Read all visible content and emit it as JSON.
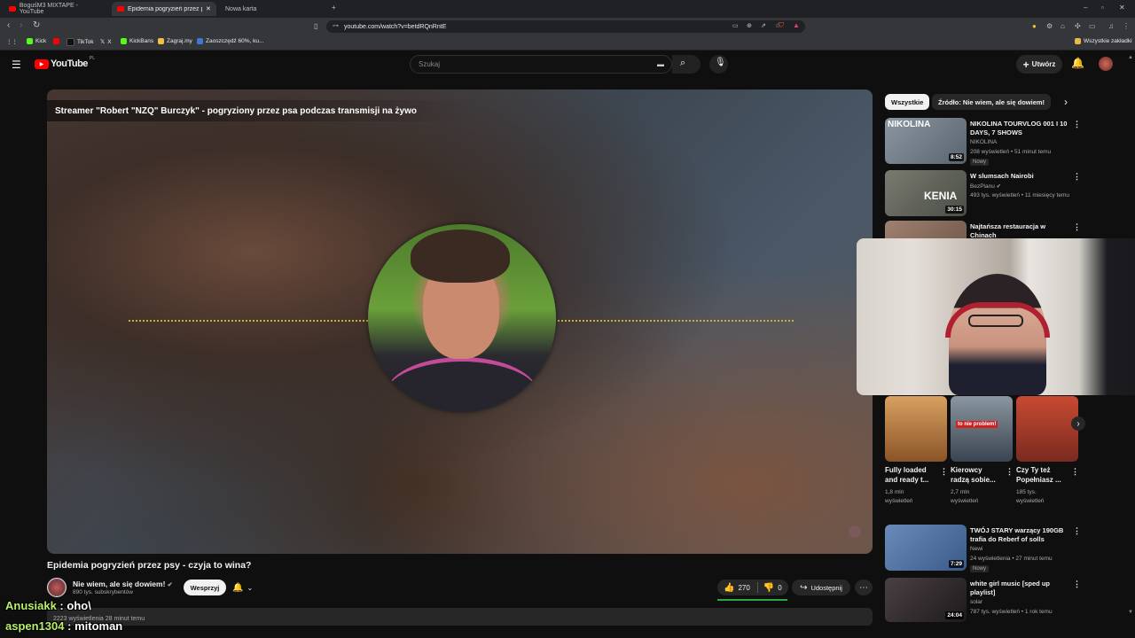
{
  "browser": {
    "tabs": [
      {
        "label": "BoguśM3 MIXTAPE - YouTube",
        "active": false
      },
      {
        "label": "Epidemia pogryzień przez ps",
        "active": true
      },
      {
        "label": "Nowa karta",
        "active": false
      }
    ],
    "url": "youtube.com/watch?v=betdRQnRntE",
    "bookmarks": [
      {
        "label": "Kick",
        "color": "#53fc18"
      },
      {
        "label": "",
        "color": "#ff0000"
      },
      {
        "label": "TikTok",
        "color": "#000000"
      },
      {
        "label": "X",
        "color": "#000000"
      },
      {
        "label": "KickBans",
        "color": "#53fc18"
      },
      {
        "label": "Zagraj.my",
        "color": "#f0c040"
      },
      {
        "label": "Zaoszczędź 60%, ku...",
        "color": "#3a7bd5"
      }
    ],
    "bookmarks_all": "Wszystkie zakładki"
  },
  "youtube": {
    "logo": "YouTube",
    "region": "PL",
    "search_placeholder": "Szukaj",
    "create_label": "Utwórz"
  },
  "video": {
    "overlay_title": "Streamer \"Robert \"NZQ\" Burczyk\" - pogryziony przez psa podczas transmisji na żywo",
    "title": "Epidemia pogryzień przez psy - czyja to wina?",
    "channel": "Nie wiem, ale się dowiem!",
    "subscribers": "890 tys. subskrybentów",
    "support_label": "Wesprzyj",
    "likes": "270",
    "dislikes": "0",
    "share_label": "Udostępnij",
    "description_preview": "2223 wyświetlenia  28 minut temu"
  },
  "chat": [
    {
      "user": "Anusiakk",
      "message": "oho\\"
    },
    {
      "user": "aspen1304",
      "message": "mitoman"
    }
  ],
  "sidebar": {
    "chips": [
      "Wszystkie",
      "Źródło: Nie wiem, ale się dowiem!"
    ],
    "recommendations": [
      {
        "title": "NIKOLINA TOURVLOG 001 I 10 DAYS, 7 SHOWS",
        "channel": "NIKOLINA",
        "meta": "208 wyświetleń • 51 minut temu",
        "badge": "Nowy",
        "duration": "8:52",
        "thumb_text": "NIKOLINA",
        "thumb_color": "#7a8a9a"
      },
      {
        "title": "W slumsach Nairobi",
        "channel": "BezPlanu",
        "meta": "493 tys. wyświetleń • 11 miesięcy temu",
        "badge": "",
        "duration": "30:15",
        "thumb_text": "KENIA",
        "thumb_color": "#6a6a62"
      },
      {
        "title": "Najtańsza restauracja w Chinach",
        "channel": "",
        "meta": "",
        "badge": "",
        "duration": "",
        "thumb_text": "",
        "thumb_color": "#8a7060"
      }
    ],
    "shorts": [
      {
        "title": "Fully loaded and ready t...",
        "views_count": "1,8 mln",
        "views_label": "wyświetleń",
        "thumb_color": "#b0743a"
      },
      {
        "title": "Kierowcy radzą sobie...",
        "views_count": "2,7 mln",
        "views_label": "wyświetleń",
        "thumb_color": "#5a6470",
        "thumb_text": "to nie problem!"
      },
      {
        "title": "Czy Ty też Popełniasz ...",
        "views_count": "185 tys.",
        "views_label": "wyświetleń",
        "thumb_color": "#c04a30"
      }
    ],
    "recommendations2": [
      {
        "title": "TWÓJ STARY warzący 190GB trafia do Reberf of solls",
        "channel": "Newi",
        "meta": "24 wyświetlenia • 27 minut temu",
        "badge": "Nowy",
        "duration": "7:29",
        "thumb_color": "#4a6a9a"
      },
      {
        "title": "white girl music [sped up playlist]",
        "channel": "solar",
        "meta": "787 tys. wyświetleń • 1 rok temu",
        "badge": "",
        "duration": "24:04",
        "thumb_color": "#3a3438"
      }
    ]
  }
}
